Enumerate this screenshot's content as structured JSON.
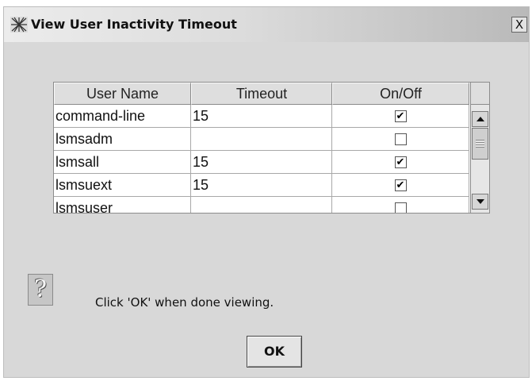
{
  "window": {
    "title": "View User Inactivity Timeout",
    "close_label": "X"
  },
  "table": {
    "columns": [
      "User Name",
      "Timeout",
      "On/Off"
    ],
    "rows": [
      {
        "user": "command-line",
        "timeout": "15",
        "on": true
      },
      {
        "user": "lsmsadm",
        "timeout": "",
        "on": false
      },
      {
        "user": "lsmsall",
        "timeout": "15",
        "on": true
      },
      {
        "user": "lsmsuext",
        "timeout": "15",
        "on": true
      },
      {
        "user": "lsmsuser",
        "timeout": "",
        "on": false
      }
    ],
    "check_glyph": "✔"
  },
  "message": {
    "icon": "question-icon",
    "icon_glyph": "?",
    "text": "Click 'OK' when done viewing."
  },
  "buttons": {
    "ok_label": "OK"
  }
}
